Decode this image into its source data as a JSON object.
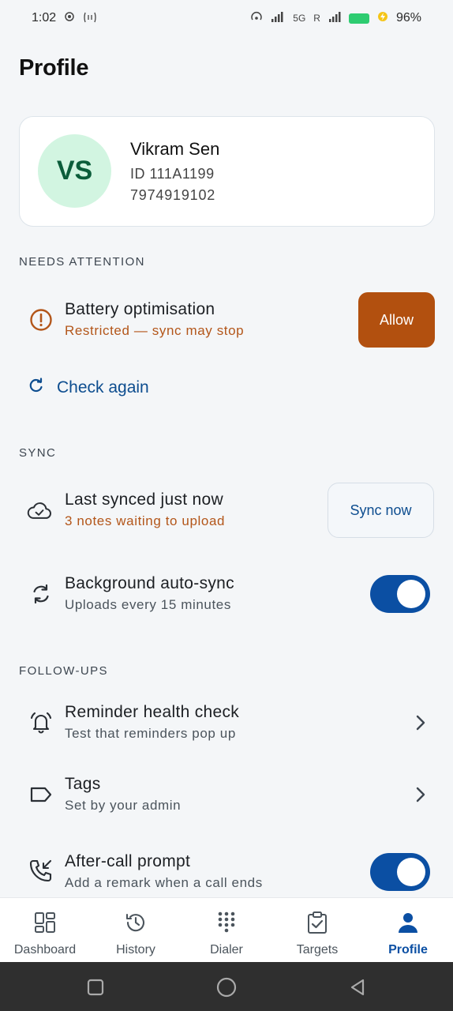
{
  "status_bar": {
    "time": "1:02",
    "left_icons": [
      "location-icon",
      "data-transfer-icon"
    ],
    "network": "5G",
    "roaming": "R",
    "battery_percent": "96%",
    "battery_color": "#2ecc71"
  },
  "page": {
    "title": "Profile"
  },
  "profile": {
    "initials": "VS",
    "name": "Vikram Sen",
    "id_line": "ID 111A1199",
    "phone": "7974919102",
    "avatar_bg": "#d2f5e1"
  },
  "needs_attention": {
    "heading": "NEEDS ATTENTION",
    "battery": {
      "title": "Battery optimisation",
      "subtitle": "Restricted — sync may stop",
      "button_label": "Allow",
      "icon": "alert-circle-icon"
    },
    "check_again_label": "Check again"
  },
  "sync": {
    "heading": "SYNC",
    "last_synced": {
      "title": "Last synced just now",
      "subtitle": "3 notes waiting to upload",
      "button_label": "Sync now",
      "icon": "cloud-check-icon"
    },
    "auto_sync": {
      "title": "Background auto-sync",
      "subtitle": "Uploads every 15 minutes",
      "enabled": true,
      "icon": "sync-icon"
    }
  },
  "follow_ups": {
    "heading": "FOLLOW-UPS",
    "reminder": {
      "title": "Reminder health check",
      "subtitle": "Test that reminders pop up",
      "icon": "alarm-bell-icon"
    },
    "tags": {
      "title": "Tags",
      "subtitle": "Set by your admin",
      "icon": "tag-icon"
    },
    "after_call": {
      "title": "After-call prompt",
      "subtitle": "Add a remark when a call ends",
      "enabled": true,
      "icon": "phone-callback-icon"
    }
  },
  "bottom_nav": {
    "items": [
      {
        "label": "Dashboard",
        "icon": "dashboard-grid-icon"
      },
      {
        "label": "History",
        "icon": "history-clock-icon"
      },
      {
        "label": "Dialer",
        "icon": "dialpad-icon"
      },
      {
        "label": "Targets",
        "icon": "clipboard-check-icon"
      },
      {
        "label": "Profile",
        "icon": "person-icon"
      }
    ],
    "active": "Profile"
  },
  "colors": {
    "accent": "#0b4fa3",
    "warning": "#b3561a",
    "allow_button": "#b2500f"
  }
}
